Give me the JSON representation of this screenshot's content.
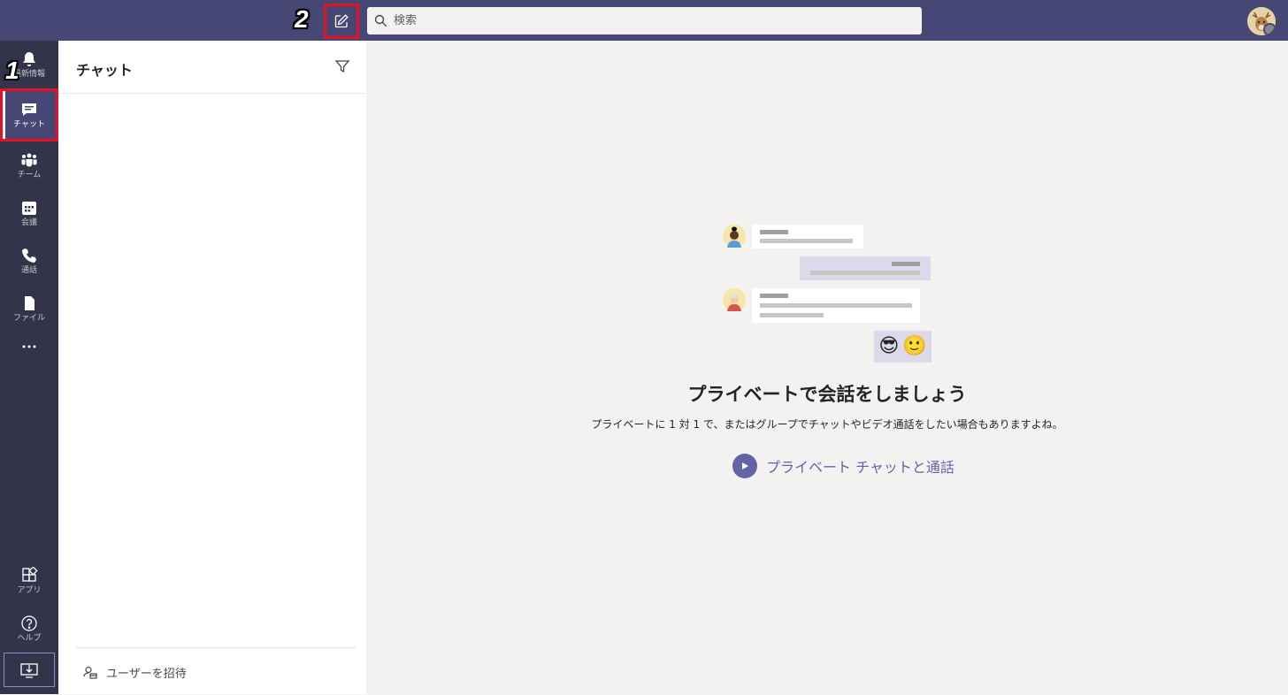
{
  "annotations": {
    "step1": "1",
    "step2": "2"
  },
  "search": {
    "placeholder": "検索"
  },
  "rail": {
    "items": [
      {
        "label": "最新情報",
        "icon": "bell-icon"
      },
      {
        "label": "チャット",
        "icon": "chat-icon"
      },
      {
        "label": "チーム",
        "icon": "teams-icon"
      },
      {
        "label": "会議",
        "icon": "calendar-icon"
      },
      {
        "label": "通話",
        "icon": "phone-icon"
      },
      {
        "label": "ファイル",
        "icon": "file-icon"
      },
      {
        "label": "",
        "icon": "more-icon"
      },
      {
        "label": "アプリ",
        "icon": "apps-icon"
      },
      {
        "label": "ヘルプ",
        "icon": "help-icon"
      }
    ],
    "active": "チャット"
  },
  "panel": {
    "title": "チャット",
    "invite_label": "ユーザーを招待"
  },
  "main": {
    "emojis": [
      "😎",
      "🙂"
    ],
    "headline": "プライベートで会話をしましょう",
    "subline": "プライベートに 1 対 1 で、またはグループでチャットやビデオ通話をしたい場合もありますよね。",
    "cta_label": "プライベート チャットと通話"
  },
  "colors": {
    "topbar": "#464775",
    "rail": "#33344a",
    "accent": "#6264a7",
    "annotation_box": "#e81123"
  }
}
